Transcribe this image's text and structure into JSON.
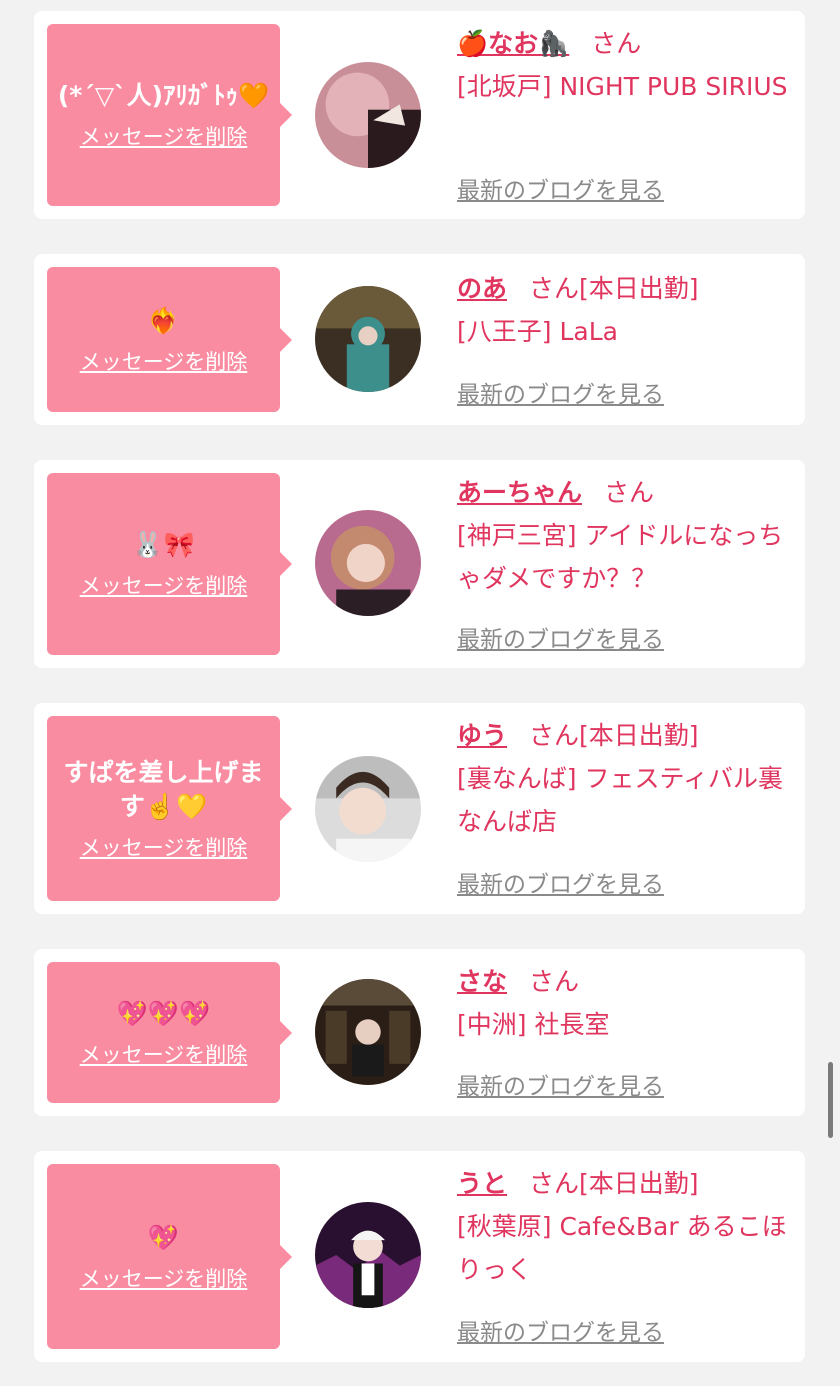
{
  "items": [
    {
      "message": "(*´▽`人)ｱﾘｶﾞﾄｩ🧡",
      "delete_label": "メッセージを削除",
      "name": "🍎なお🦍",
      "honorific": "さん",
      "status": "",
      "shop": "[北坂戸] NIGHT PUB SIRIUS",
      "blog_label": "最新のブログを見る"
    },
    {
      "message": "❤️‍🔥",
      "delete_label": "メッセージを削除",
      "name": "のあ",
      "honorific": "さん",
      "status": "[本日出勤]",
      "shop": "[八王子] LaLa",
      "blog_label": "最新のブログを見る"
    },
    {
      "message": "🐰🎀",
      "delete_label": "メッセージを削除",
      "name": "あーちゃん",
      "honorific": "さん",
      "status": "",
      "shop": "[神戸三宮] アイドルになっちゃダメですか？？",
      "blog_label": "最新のブログを見る"
    },
    {
      "message": "すぱを差し上げます☝️💛",
      "delete_label": "メッセージを削除",
      "name": "ゆう",
      "honorific": "さん",
      "status": "[本日出勤]",
      "shop": "[裏なんば] フェスティバル裏なんば店",
      "blog_label": "最新のブログを見る"
    },
    {
      "message": "💖💖💖",
      "delete_label": "メッセージを削除",
      "name": "さな",
      "honorific": "さん",
      "status": "",
      "shop": "[中洲] 社長室",
      "blog_label": "最新のブログを見る"
    },
    {
      "message": "💖",
      "delete_label": "メッセージを削除",
      "name": "うと",
      "honorific": "さん",
      "status": "[本日出勤]",
      "shop": "[秋葉原] Cafe&Bar あるこほりっく",
      "blog_label": "最新のブログを見る"
    }
  ]
}
